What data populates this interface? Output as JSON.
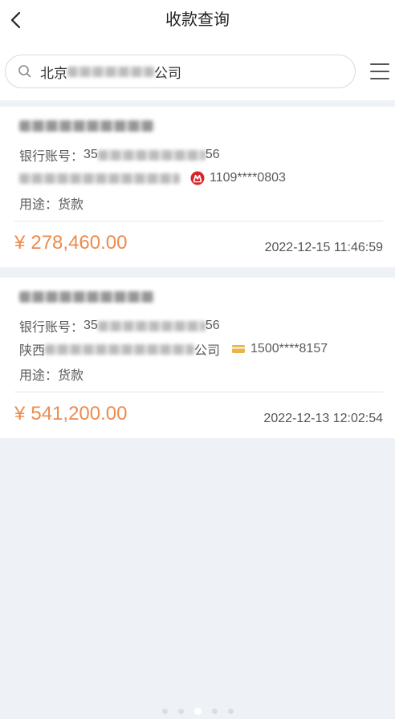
{
  "header": {
    "title": "收款查询",
    "back_icon": "chevron-left-icon"
  },
  "search": {
    "icon": "search-icon",
    "value_prefix": "北京",
    "value_suffix": "公司",
    "menu_icon": "hamburger-menu-icon"
  },
  "records": [
    {
      "account_label": "银行账号：",
      "account_prefix": "35",
      "account_suffix": "56",
      "bank_icon": "bank-logo-icon",
      "bank_card": "1109****0803",
      "purpose_label": "用途：",
      "purpose": "货款",
      "currency": "¥",
      "amount": "278,460.00",
      "time": "2022-12-15 11:46:59"
    },
    {
      "account_label": "银行账号：",
      "account_prefix": "35",
      "account_suffix": "56",
      "counterparty_prefix": "陕西",
      "counterparty_suffix": "公司",
      "bank_icon": "bank-card-icon",
      "bank_card": "1500****8157",
      "purpose_label": "用途：",
      "purpose": "货款",
      "currency": "¥",
      "amount": "541,200.00",
      "time": "2022-12-13 12:02:54"
    }
  ],
  "page_indicator": {
    "count": 5,
    "active": 2
  },
  "colors": {
    "background": "#eef2f7",
    "amount": "#ec8b4e",
    "bank_logo": "#d6262c",
    "card_icon": "#e8b54b"
  }
}
